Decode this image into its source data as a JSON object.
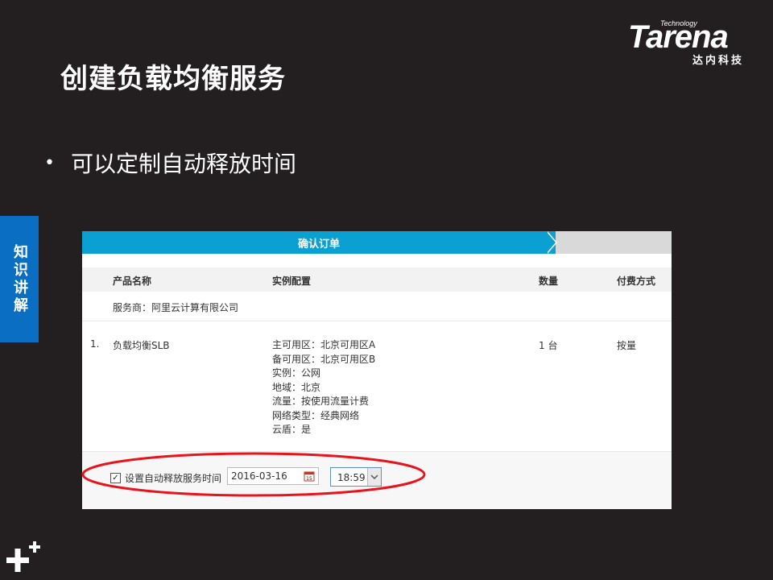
{
  "slide": {
    "title": "创建负载均衡服务",
    "bullet": "可以定制自动释放时间",
    "side_tab": "知识讲解"
  },
  "logo": {
    "tech": "Technology",
    "word": "Tarena",
    "sub": "达内科技"
  },
  "screenshot": {
    "step_label": "确认订单",
    "headers": {
      "product": "产品名称",
      "config": "实例配置",
      "quantity": "数量",
      "payment": "付费方式"
    },
    "vendor": "服务商：阿里云计算有限公司",
    "row": {
      "index": "1.",
      "product": "负载均衡SLB",
      "quantity": "1 台",
      "payment": "按量",
      "config": [
        "主可用区：北京可用区A",
        "备可用区：北京可用区B",
        "实例：公网",
        "地域：北京",
        "流量：按使用流量计费",
        "网络类型：经典网络",
        "云盾：是"
      ]
    },
    "release": {
      "checkbox_label": "设置自动释放服务时间",
      "checked": true,
      "date": "2016-03-16",
      "time": "18:59"
    }
  },
  "colors": {
    "background": "#231f20",
    "side_tab": "#0a6fc2",
    "step_active": "#0aa0d2",
    "highlight_ellipse": "#e8141c"
  }
}
